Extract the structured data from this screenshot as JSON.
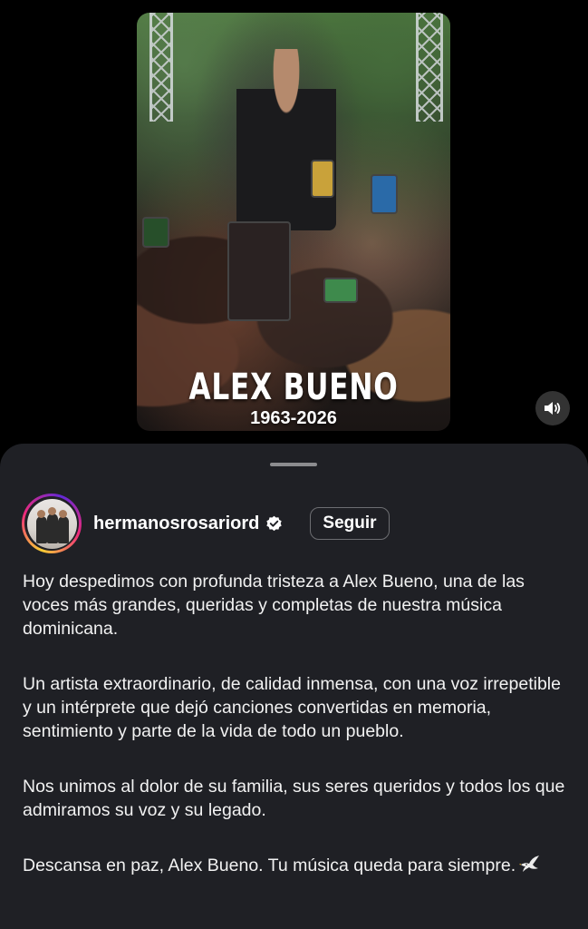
{
  "video": {
    "title_text": "ALEX BUENO",
    "years_text": "1963-2026",
    "volume_icon": "speaker-icon"
  },
  "post": {
    "username": "hermanosrosariord",
    "verified_icon": "verified-badge-icon",
    "follow_label": "Seguir",
    "caption": [
      "Hoy despedimos con profunda tristeza a Alex Bueno, una de las voces más grandes, queridas y completas de nuestra música dominicana.",
      "Un artista extraordinario, de calidad inmensa, con una voz irrepetible y un intérprete que dejó canciones convertidas en memoria, sentimiento y parte de la vida de todo un pueblo.",
      "Nos unimos al dolor de su familia, sus seres queridos y todos los que admiramos su voz y su legado.",
      "Descansa en paz, Alex Bueno. Tu música queda para siempre."
    ],
    "caption_end_icon": "dove-icon"
  },
  "colors": {
    "background": "#000000",
    "sheet": "#1f2025",
    "text": "#ffffff",
    "verified": "#ffffff"
  }
}
